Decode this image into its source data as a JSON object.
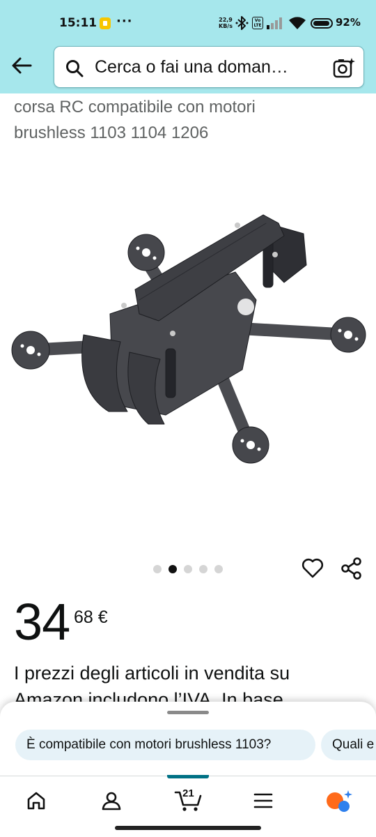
{
  "status_bar": {
    "time": "15:11",
    "dots": "···",
    "speed_top": "22,9",
    "speed_bottom": "KB/s",
    "volte_top": "Vo",
    "volte_bottom": "LTE",
    "battery": "92%"
  },
  "search": {
    "text": "Cerca o fai una doman…"
  },
  "product": {
    "title_line1": "corsa RC compatibile con motori",
    "title_line2": "brushless 1103 1104 1206",
    "image_count": 5,
    "active_image": 2,
    "price_whole": "34",
    "price_fraction": "68 €",
    "vat_note": "I prezzi degli articoli in vendita su",
    "vat_note_cut": "Amazon includono l’IVA. In base"
  },
  "suggestions": [
    "È compatibile con motori brushless 1103?",
    "Quali e"
  ],
  "nav": {
    "cart_count": "21"
  },
  "colors": {
    "header_bg": "#a6e7ec",
    "cart_accent": "#007185",
    "chip_bg": "#e6f2f8"
  }
}
